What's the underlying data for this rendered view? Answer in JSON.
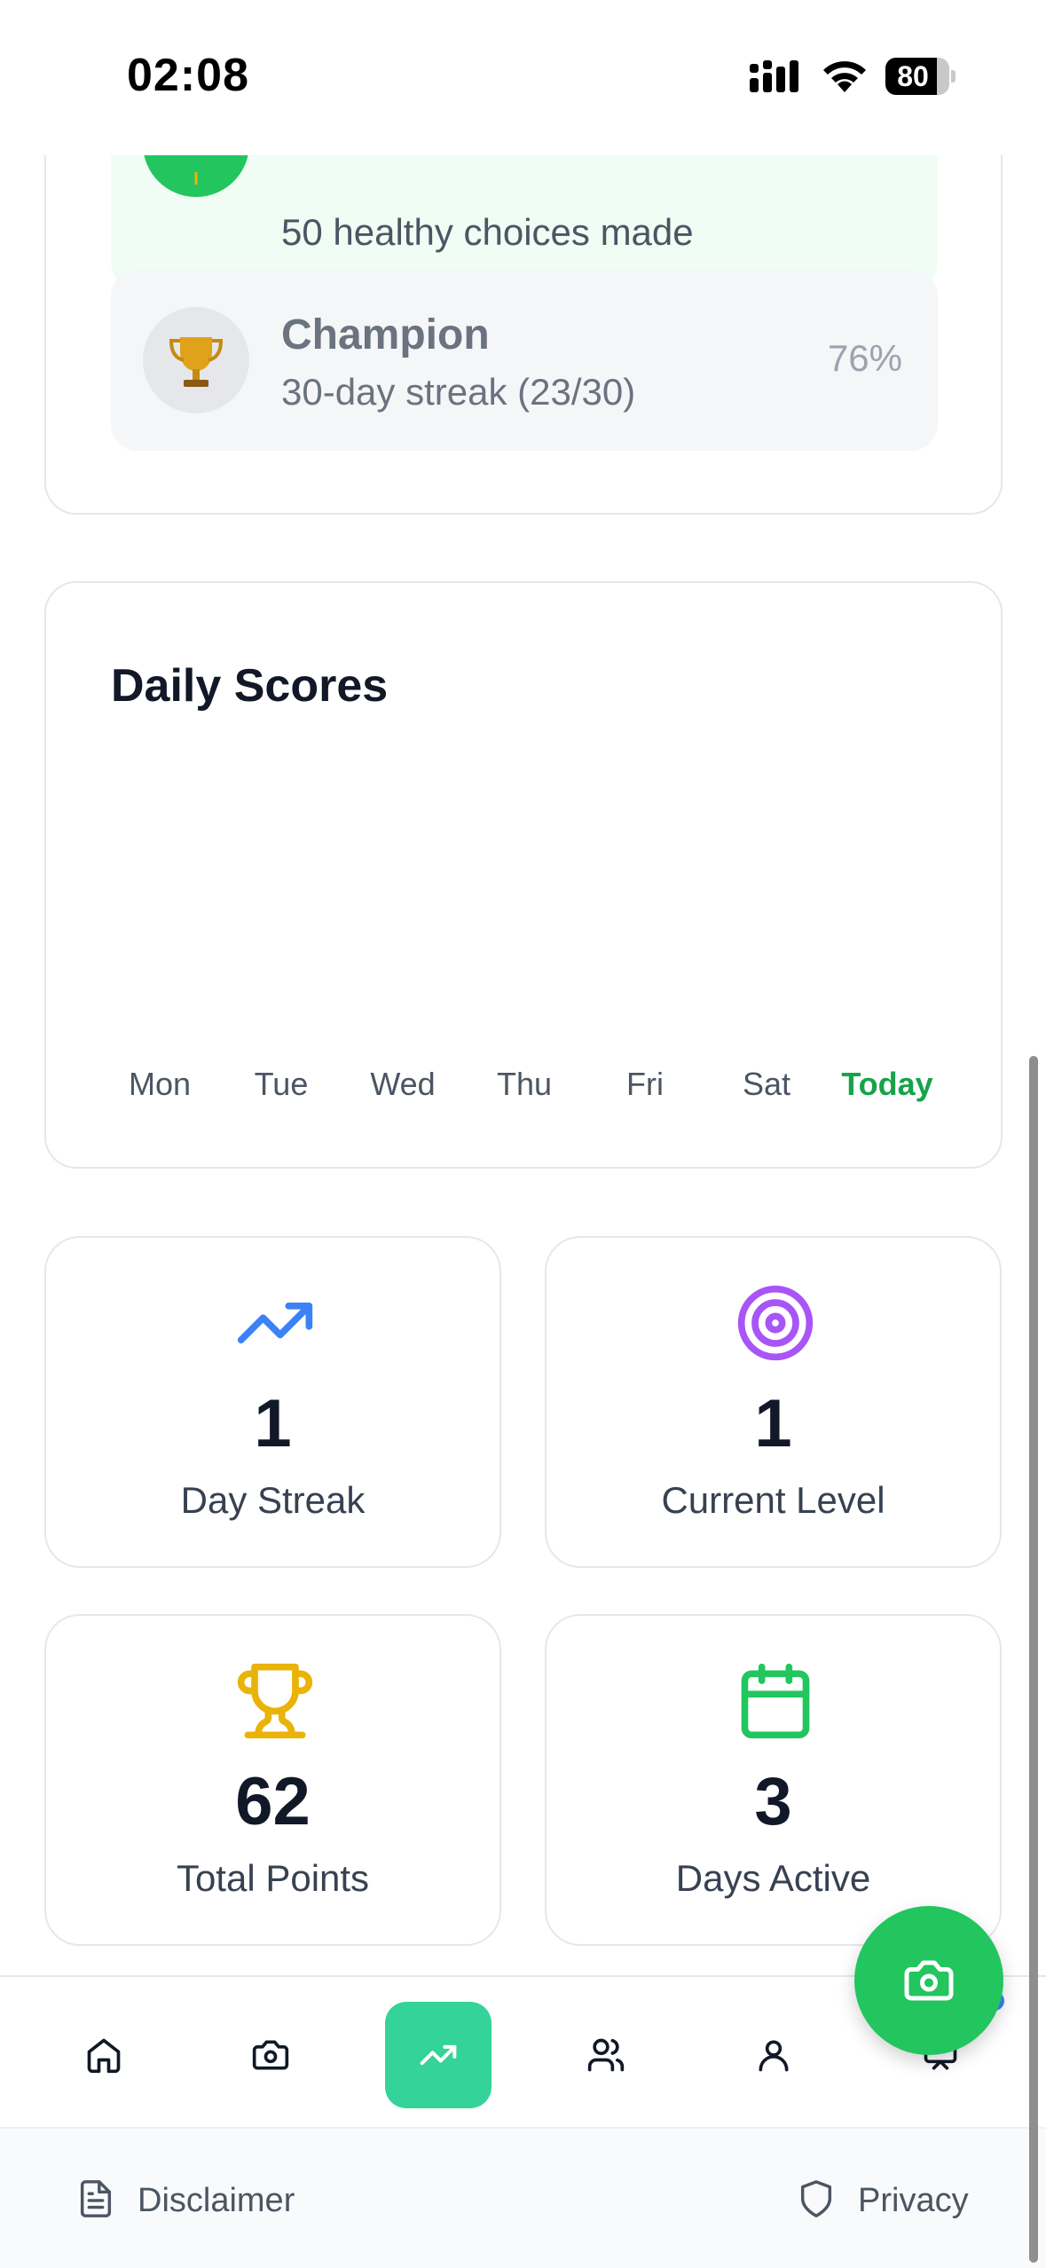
{
  "status_bar": {
    "time": "02:08",
    "battery": "80",
    "battery_level": 0.8
  },
  "achievements": [
    {
      "icon": "green-badge-icon",
      "title": "",
      "subtitle": "50 healthy choices made",
      "percent": ""
    },
    {
      "icon": "trophy-emoji-icon",
      "emoji": "🏆",
      "title": "Champion",
      "subtitle": "30-day streak (23/30)",
      "percent": "76%"
    }
  ],
  "daily_scores": {
    "title": "Daily Scores",
    "days": [
      "Mon",
      "Tue",
      "Wed",
      "Thu",
      "Fri",
      "Sat",
      "Today"
    ]
  },
  "stats": [
    {
      "icon": "trending-up-icon",
      "value": "1",
      "label": "Day Streak",
      "color": "#3b82f6"
    },
    {
      "icon": "target-icon",
      "value": "1",
      "label": "Current Level",
      "color": "#a855f7"
    },
    {
      "icon": "trophy-icon",
      "value": "62",
      "label": "Total Points",
      "color": "#eab308"
    },
    {
      "icon": "calendar-icon",
      "value": "3",
      "label": "Days Active",
      "color": "#22c55e"
    }
  ],
  "bottom_nav": {
    "items": [
      "home-icon",
      "camera-icon",
      "progress-icon",
      "users-icon",
      "user-icon",
      "cast-icon"
    ],
    "active": "progress-icon"
  },
  "footer": {
    "disclaimer": "Disclaimer",
    "privacy": "Privacy"
  },
  "colors": {
    "primary": "#22c55e",
    "active_nav": "#34d399",
    "text_dark": "#111827",
    "text_muted": "#6b7280"
  }
}
